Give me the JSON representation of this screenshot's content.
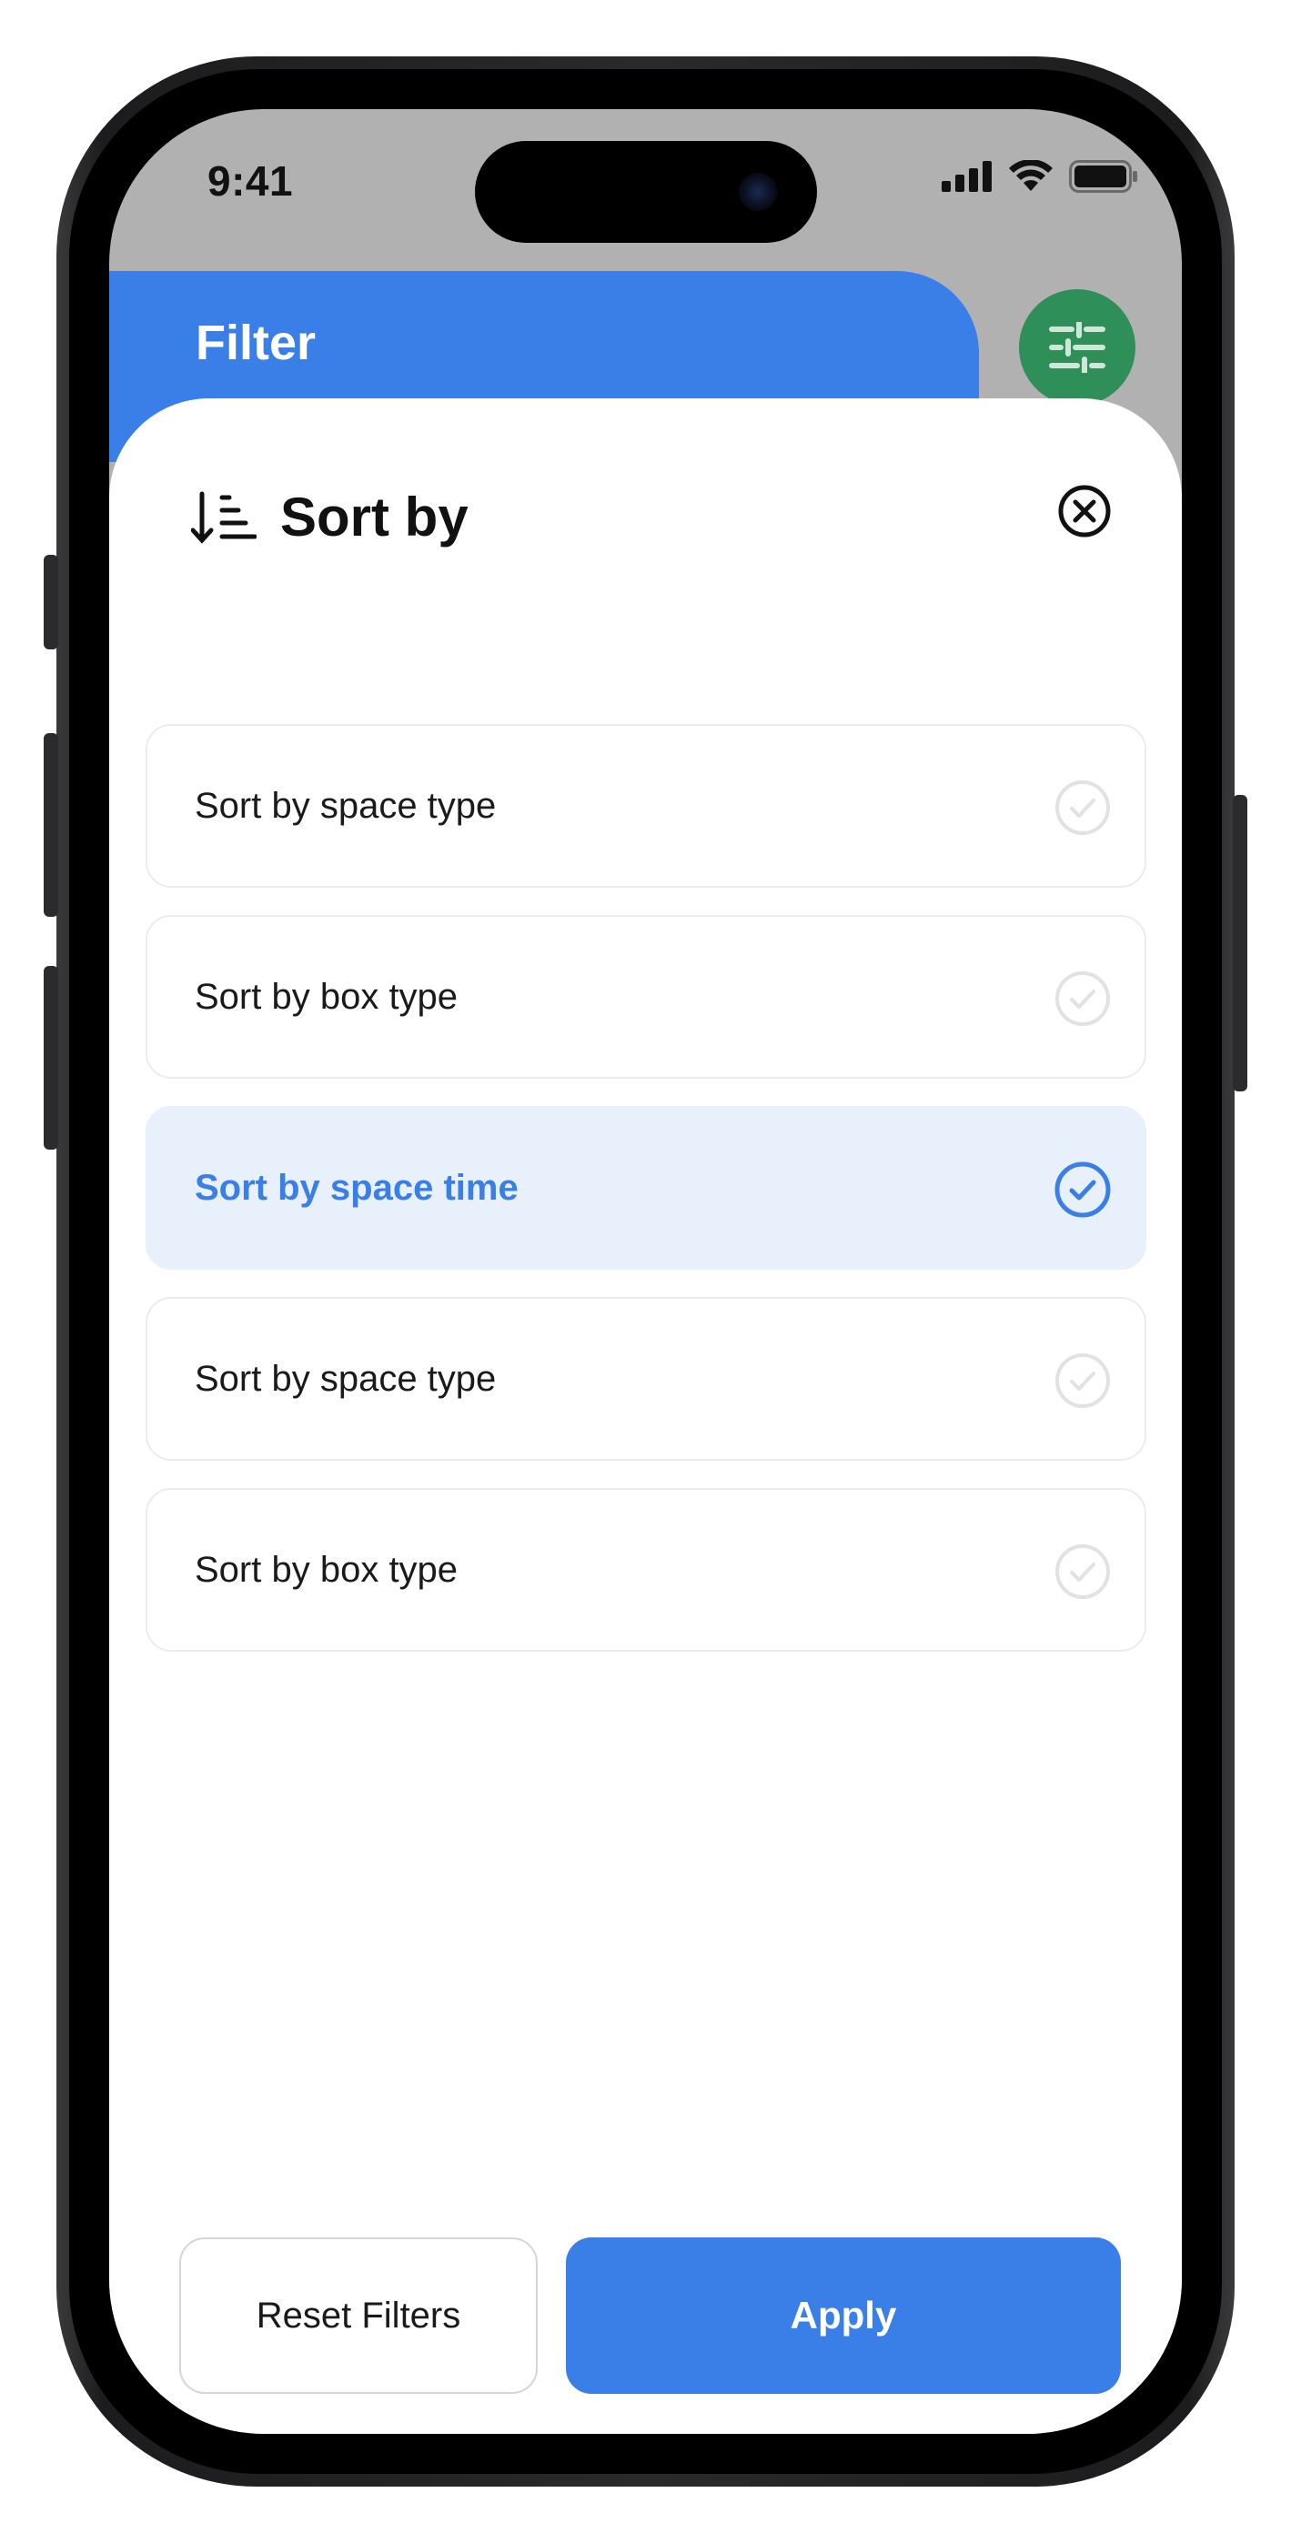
{
  "status_bar": {
    "time": "9:41"
  },
  "header": {
    "title": "Filter",
    "filter_icon": "sliders-icon"
  },
  "sheet": {
    "title": "Sort by",
    "title_icon": "sort-descending-icon",
    "close_icon": "close-circle-icon",
    "options": [
      {
        "label": "Sort by space type",
        "selected": false
      },
      {
        "label": "Sort by box type",
        "selected": false
      },
      {
        "label": "Sort by space time",
        "selected": true
      },
      {
        "label": "Sort by space type",
        "selected": false
      },
      {
        "label": "Sort by box type",
        "selected": false
      }
    ]
  },
  "actions": {
    "reset_label": "Reset Filters",
    "apply_label": "Apply"
  },
  "colors": {
    "accent": "#3a7fe8",
    "fab": "#2f8f58",
    "selected_bg": "#e8f0fc"
  }
}
